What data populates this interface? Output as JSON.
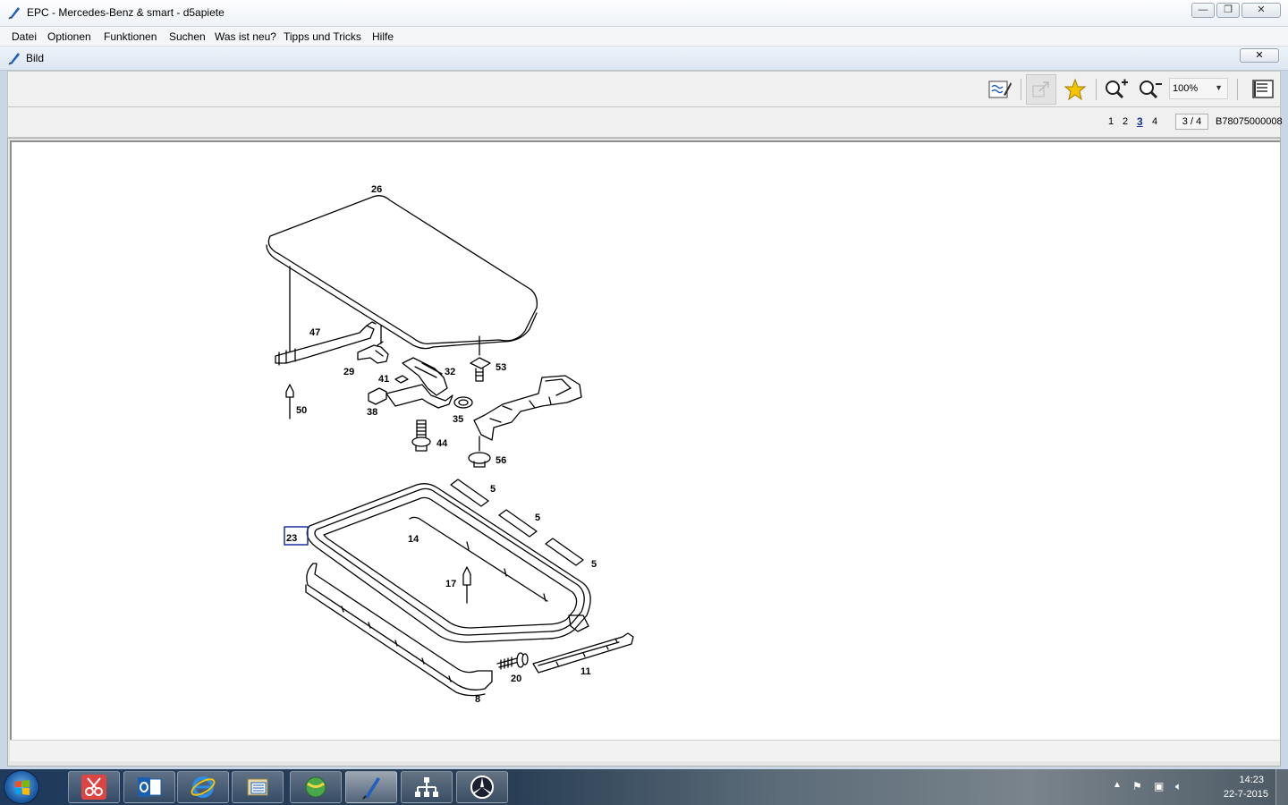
{
  "window": {
    "title": "EPC - Mercedes-Benz & smart - d5apiete",
    "minimize": "—",
    "maximize": "❐",
    "close": "✕"
  },
  "menu": {
    "items": [
      "Datei",
      "Optionen",
      "Funktionen",
      "Suchen",
      "Was ist neu?",
      "Tipps und Tricks",
      "Hilfe"
    ]
  },
  "subwindow": {
    "title": "Bild",
    "close": "✕"
  },
  "toolbar": {
    "zoom_value": "100%",
    "icons": [
      "edit-notes-icon",
      "expand-icon",
      "favorite-star-icon",
      "zoom-in-icon",
      "zoom-out-icon",
      "page-icon"
    ]
  },
  "pagenav": {
    "pages": [
      "1",
      "2",
      "3",
      "4"
    ],
    "active_page": "3",
    "counter": "3 / 4",
    "image_code": "B78075000008"
  },
  "drawing": {
    "labels": [
      "26",
      "47",
      "29",
      "41",
      "32",
      "53",
      "50",
      "38",
      "35",
      "44",
      "56",
      "5",
      "5",
      "5",
      "23",
      "14",
      "17",
      "20",
      "11",
      "8"
    ],
    "highlighted_label": "23"
  },
  "taskbar": {
    "time": "14:23",
    "date": "22-7-2015"
  }
}
